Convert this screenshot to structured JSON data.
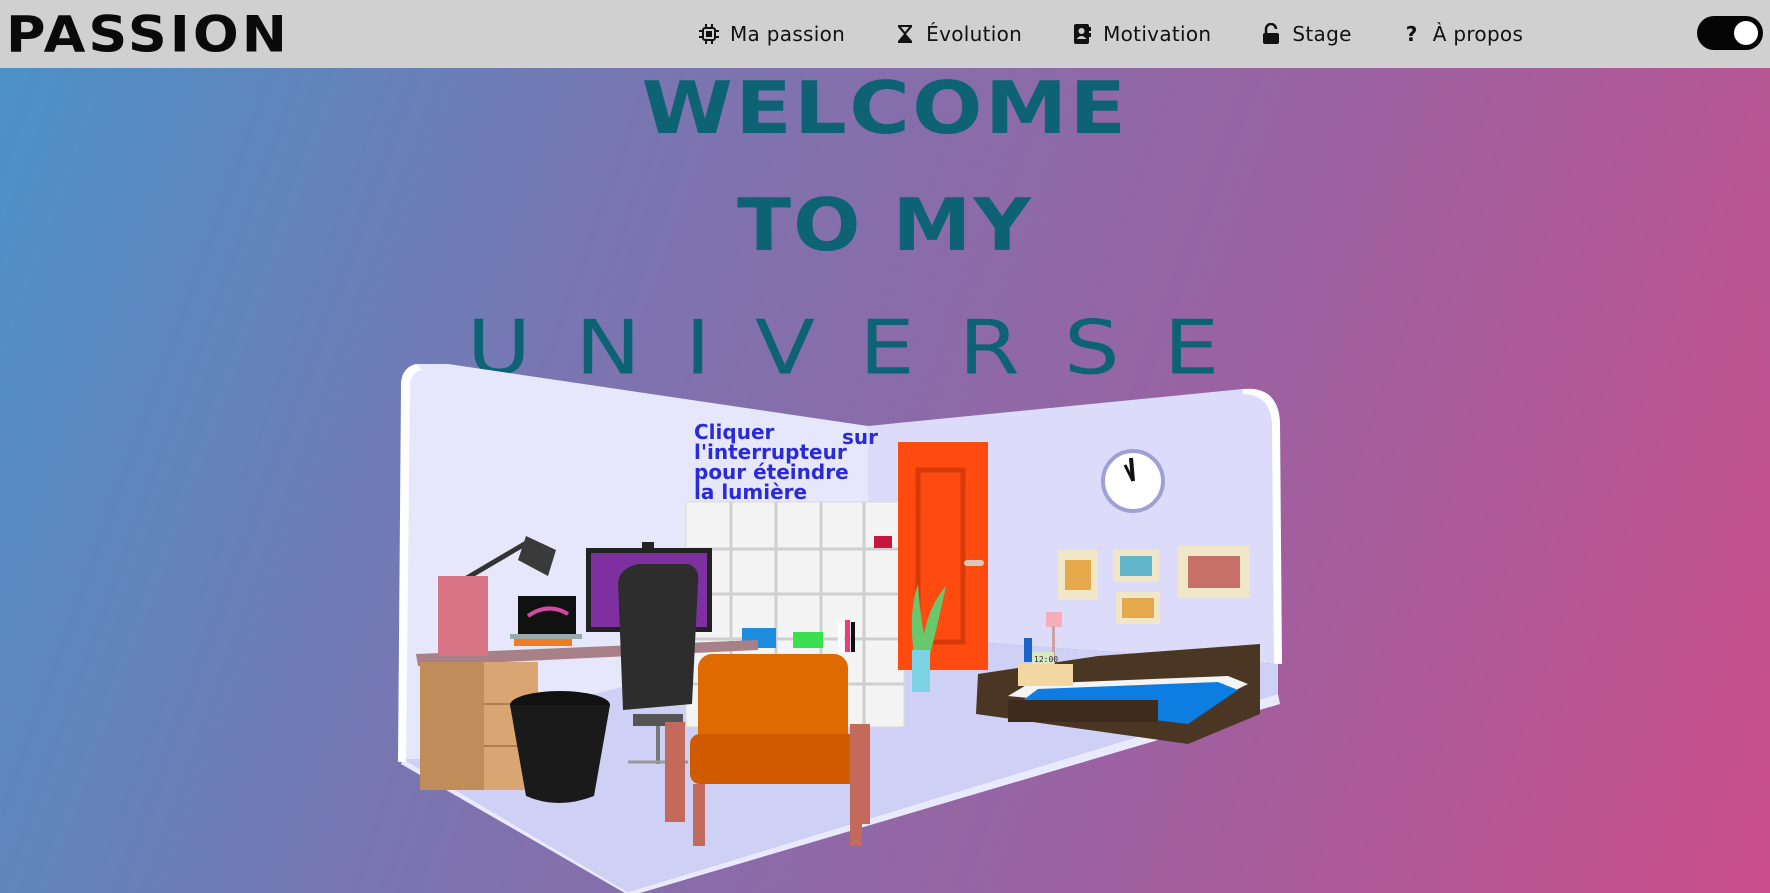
{
  "logo": {
    "text": "PASSION"
  },
  "nav": {
    "items": [
      {
        "label": "Ma passion",
        "icon": "chip-icon"
      },
      {
        "label": "Évolution",
        "icon": "hourglass-icon"
      },
      {
        "label": "Motivation",
        "icon": "contact-book-icon"
      },
      {
        "label": "Stage",
        "icon": "unlock-icon"
      },
      {
        "label": "À propos",
        "icon": "question-icon"
      }
    ]
  },
  "theme_toggle": {
    "state": "on"
  },
  "hero": {
    "line1": "WELCOME",
    "line2": "TO MY",
    "line3": "UNIVERSE"
  },
  "room_scene": {
    "wall_text": [
      "Cliquer",
      "sur",
      "l'interrupteur",
      "pour éteindre",
      "la lumière"
    ],
    "clock_display": "12:00"
  },
  "colors": {
    "nav_bg": "#d0d0d0",
    "heading": "#0d6374",
    "wall_text": "#2b2bd6",
    "door": "#ff4a10",
    "toggle": "#050505"
  }
}
